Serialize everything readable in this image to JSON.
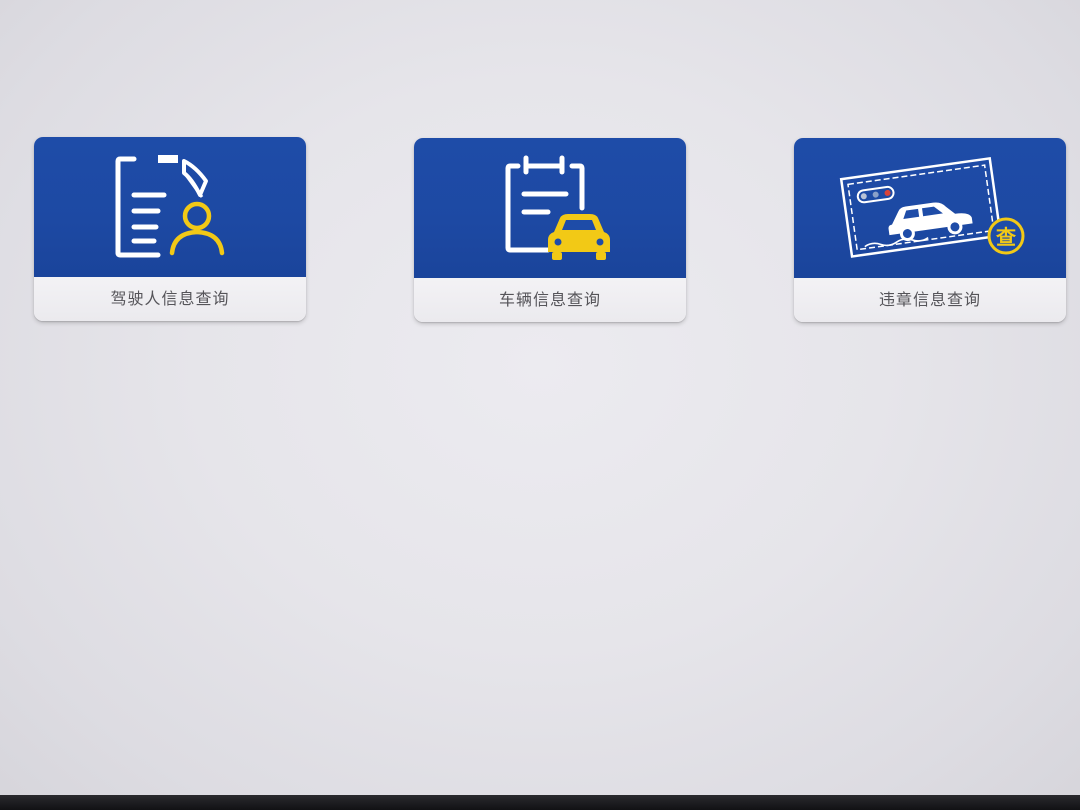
{
  "menu": {
    "cards": [
      {
        "label": "驾驶人信息查询",
        "icon": "driver-document-icon"
      },
      {
        "label": "车辆信息查询",
        "icon": "vehicle-clipboard-icon"
      },
      {
        "label": "违章信息查询",
        "icon": "violation-ticket-icon",
        "badge": "查"
      }
    ]
  },
  "colors": {
    "card_blue": "#1e4ca8",
    "icon_white": "#ffffff",
    "icon_yellow": "#f2c916",
    "label_bg": "#f1f0f3",
    "label_text": "#555459"
  }
}
